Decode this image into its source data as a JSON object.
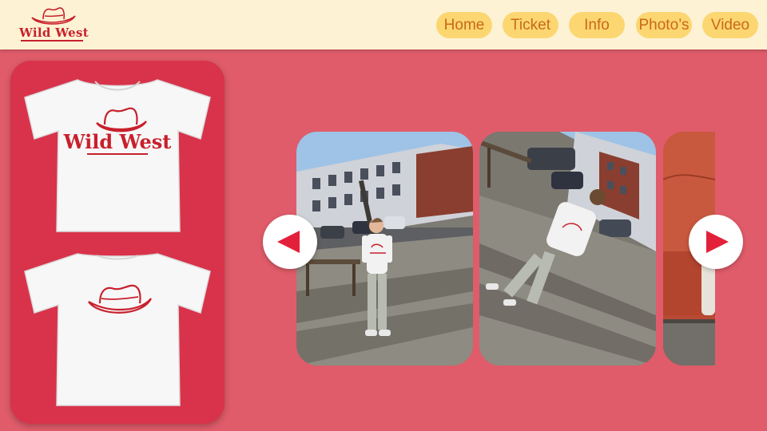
{
  "brand": {
    "logo_text": "Wild West",
    "accent": "#c8202c"
  },
  "nav": {
    "items": [
      {
        "label": "Home"
      },
      {
        "label": "Ticket"
      },
      {
        "label": "Info"
      },
      {
        "label": "Photo’s"
      },
      {
        "label": "Video"
      }
    ],
    "button_bg": "#fcd671",
    "button_text": "#c86a16"
  },
  "merch": {
    "front_print_text": "Wild West",
    "panel_color": "#d8334b"
  },
  "carousel": {
    "prev_icon": "triangle-left-icon",
    "next_icon": "triangle-right-icon",
    "photos": [
      {
        "scene": "person-front-shirt"
      },
      {
        "scene": "person-back-shirt"
      },
      {
        "scene": "red-couch"
      }
    ]
  },
  "colors": {
    "page_bg": "#e05c6a",
    "header_bg": "#fdf2d4"
  }
}
